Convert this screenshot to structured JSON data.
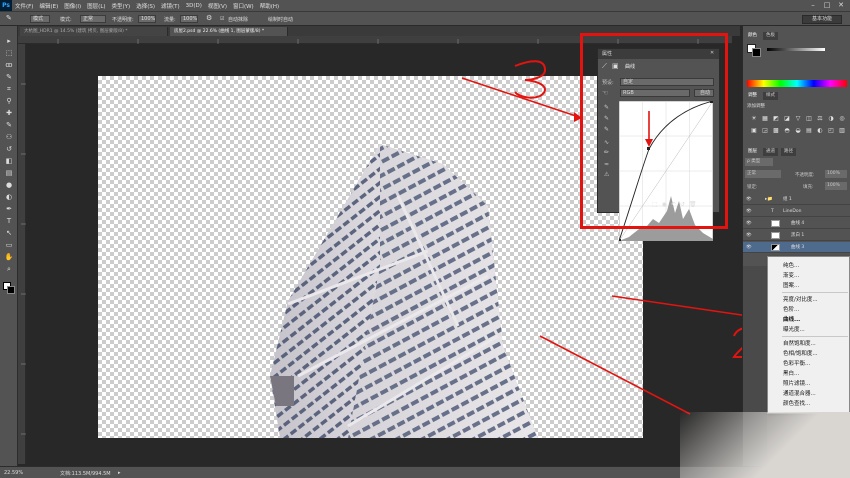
{
  "app": {
    "logo": "Ps"
  },
  "menu": [
    "文件(F)",
    "编辑(E)",
    "图像(I)",
    "图层(L)",
    "类型(Y)",
    "选择(S)",
    "滤镜(T)",
    "3D(D)",
    "视图(V)",
    "窗口(W)",
    "帮助(H)"
  ],
  "window_controls": {
    "minimize": "–",
    "maximize": "□",
    "close": "✕"
  },
  "options": {
    "brush_mode": "模式",
    "mode_label": "模式:",
    "normal": "正常",
    "opacity_label": "不透明度:",
    "opacity_value": "100%",
    "flow_label": "流量:",
    "flow_value": "100%",
    "auto_note": "自动抹除",
    "always_pressure": "绘制时自动",
    "workspace": "基本功能"
  },
  "tabs": [
    "大杭图_HDR1 @ 14.5% (建筑 拷贝, 图层蒙版/8) *",
    "房屋2.psd @ 22.6% (曲线 1, 图层蒙版/8) *"
  ],
  "tools": [
    "arrow-icon",
    "marquee-icon",
    "lasso-icon",
    "quick-select-icon",
    "crop-icon",
    "eyedropper-icon",
    "heal-icon",
    "brush-icon",
    "stamp-icon",
    "history-brush-icon",
    "eraser-icon",
    "gradient-icon",
    "blur-icon",
    "dodge-icon",
    "pen-icon",
    "type-icon",
    "path-select-icon",
    "shape-icon",
    "hand-icon",
    "zoom-icon"
  ],
  "tool_glyphs": [
    "▸",
    "⬚",
    "ꝏ",
    "✎",
    "⌗",
    "⚲",
    "✚",
    "✎",
    "⚇",
    "↺",
    "◧",
    "▤",
    "●",
    "◐",
    "✒",
    "T",
    "↖",
    "▭",
    "✋",
    "⌕"
  ],
  "status": {
    "zoom": "22.59%",
    "doc": "文档:113.5M/994.5M",
    "arrow": "▸"
  },
  "properties": {
    "title": "属性",
    "panel_label": "曲线",
    "preset_label": "预设:",
    "preset_value": "自定",
    "channel_value": "RGB",
    "auto_button": "自动",
    "close": "✕",
    "collapse": "▸▸"
  },
  "right_panels": {
    "color_tab": "颜色",
    "swatch_tab": "色板",
    "adjust_tab": "调整",
    "style_tab": "样式",
    "add_adjust": "添加调整",
    "layers_tab": "图层",
    "channels_tab": "通道",
    "paths_tab": "路径",
    "kind_label": "ρ 类型",
    "blend_mode": "正常",
    "opacity_label": "不透明度:",
    "opacity_value": "100%",
    "lock_label": "锁定:",
    "fill_label": "填充:",
    "fill_value": "100%",
    "layers": [
      {
        "name": "组 1"
      },
      {
        "name": "LineDon"
      },
      {
        "name": "曲线 4"
      },
      {
        "name": "黑白 1"
      },
      {
        "name": "曲线 3"
      }
    ],
    "adjust_icons": [
      "☀",
      "▦",
      "◩",
      "◪",
      "▽",
      "◫",
      "⚖",
      "◑",
      "◎",
      "▣",
      "◲",
      "▩",
      "◓",
      "◒",
      "▤",
      "◐",
      "◰",
      "▥"
    ]
  },
  "context_menu": {
    "items": [
      "纯色...",
      "渐变...",
      "图案...",
      "亮度/对比度...",
      "色阶...",
      "曲线...",
      "曝光度...",
      "自然饱和度...",
      "色相/饱和度...",
      "色彩平衡...",
      "黑白...",
      "照片滤镜...",
      "通道混合器...",
      "颜色查找..."
    ],
    "highlighted": "曲线..."
  },
  "annotations": [
    "3",
    "2"
  ],
  "colors": {
    "annotation_red": "#e3140f",
    "ui_dark": "#535353",
    "canvas_bg": "#282828"
  }
}
